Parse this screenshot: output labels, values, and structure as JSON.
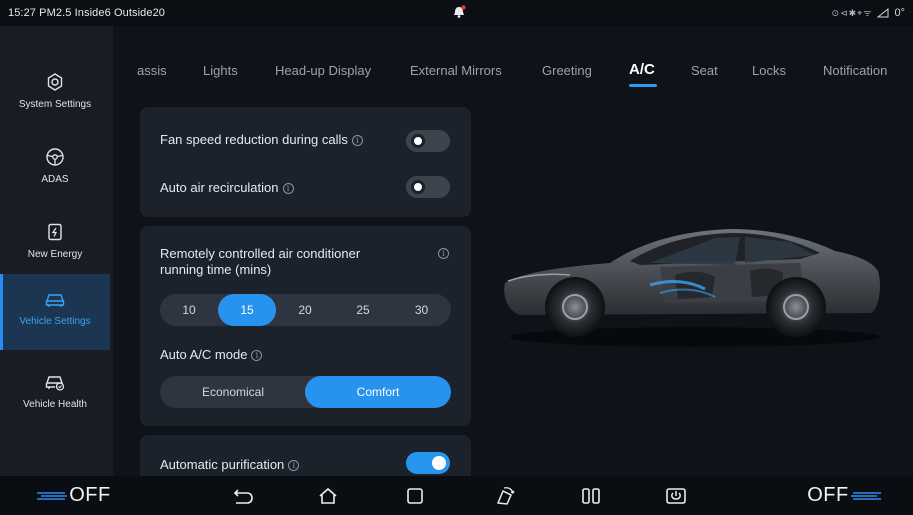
{
  "status_bar": {
    "left_text": "15:27 PM2.5 Inside6 Outside20",
    "temperature": "0°"
  },
  "sidebar": {
    "items": [
      {
        "label": "System Settings",
        "icon": "gear-icon"
      },
      {
        "label": "ADAS",
        "icon": "steering-wheel-icon"
      },
      {
        "label": "New Energy",
        "icon": "battery-icon"
      },
      {
        "label": "Vehicle Settings",
        "icon": "car-icon",
        "active": true
      },
      {
        "label": "Vehicle Health",
        "icon": "car-health-icon"
      }
    ]
  },
  "tabs": [
    {
      "label": "assis"
    },
    {
      "label": "Lights"
    },
    {
      "label": "Head-up Display"
    },
    {
      "label": "External Mirrors"
    },
    {
      "label": "Greeting"
    },
    {
      "label": "A/C",
      "active": true
    },
    {
      "label": "Seat"
    },
    {
      "label": "Locks"
    },
    {
      "label": "Notification"
    }
  ],
  "ac": {
    "fan_speed_reduction": {
      "label": "Fan speed reduction during calls",
      "on": false
    },
    "auto_recirculation": {
      "label": "Auto air recirculation",
      "on": false
    },
    "remote_runtime": {
      "label": "Remotely controlled air conditioner running time (mins)",
      "options": [
        "10",
        "15",
        "20",
        "25",
        "30"
      ],
      "selected": "15"
    },
    "auto_mode": {
      "label": "Auto A/C mode",
      "options": [
        "Economical",
        "Comfort"
      ],
      "selected": "Comfort"
    },
    "auto_purification": {
      "label": "Automatic purification",
      "on": true
    }
  },
  "bottom_bar": {
    "left_fan": "OFF",
    "right_fan": "OFF"
  },
  "colors": {
    "accent": "#2793ee",
    "active_sidebar_bg": "#1c3550",
    "card_bg": "#1b222c"
  }
}
